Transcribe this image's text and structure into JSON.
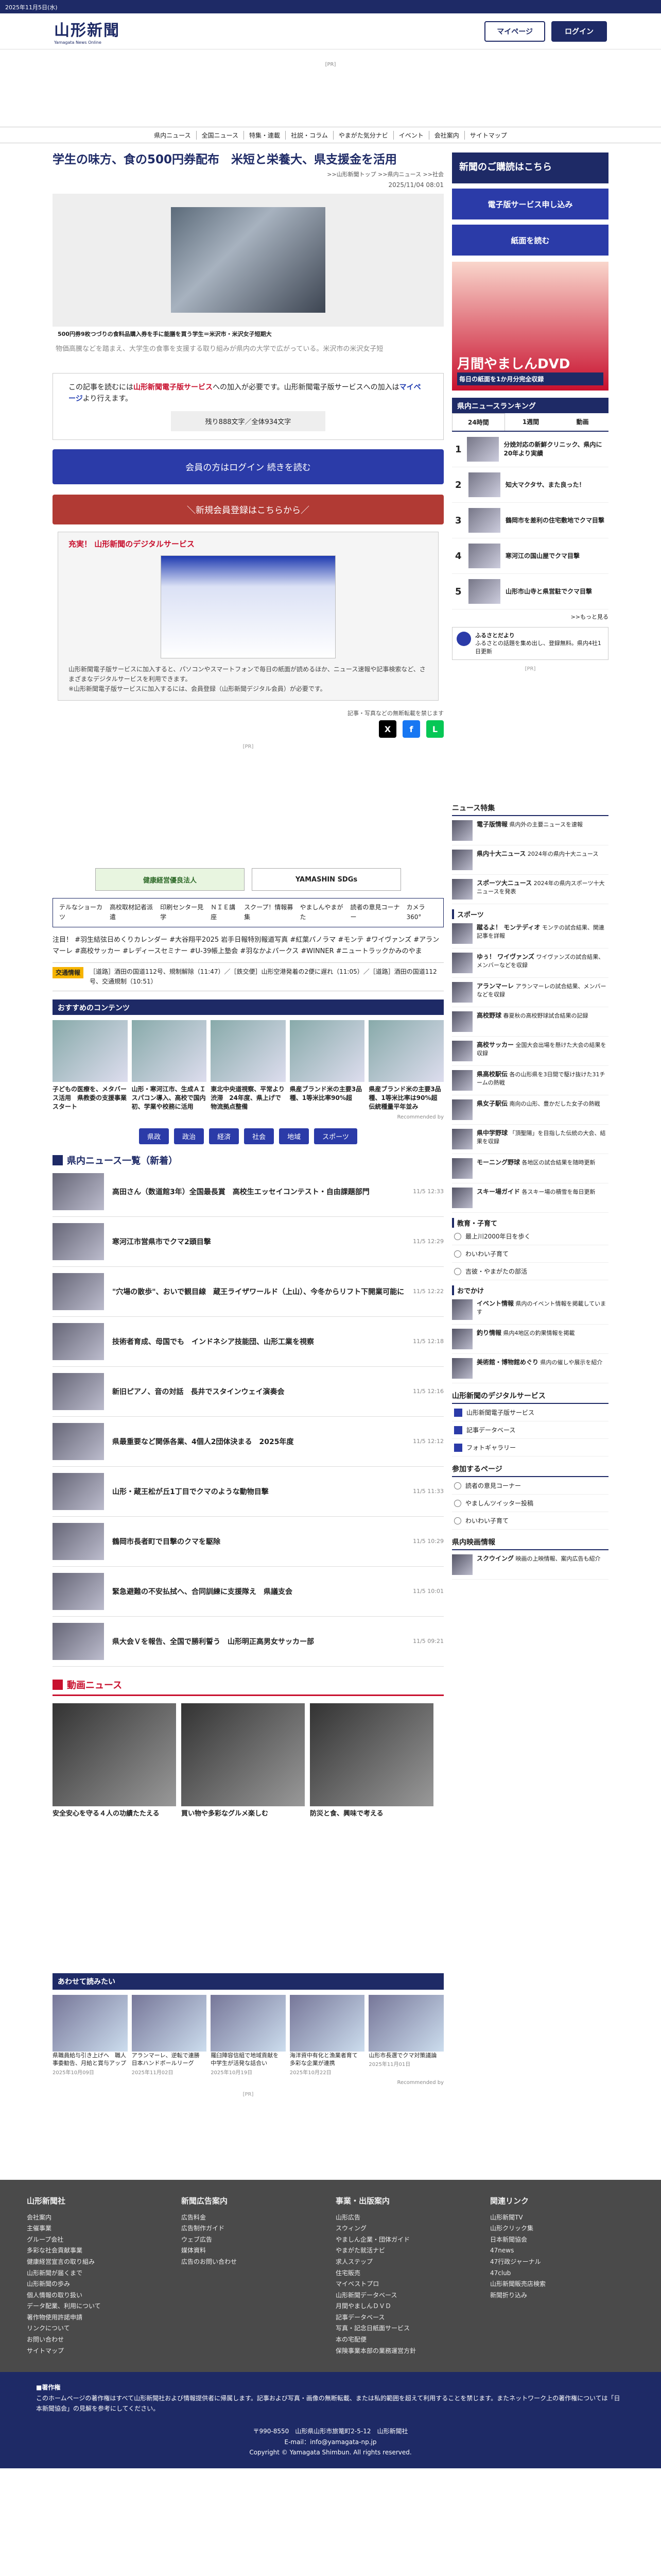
{
  "topbar": {
    "date": "2025年11月5日(水)"
  },
  "masthead": {
    "logo": "山形新聞",
    "logo_sub": "Yamagata News Online",
    "mypage": "マイページ",
    "login": "ログイン"
  },
  "pr": "[PR]",
  "gnav": [
    "県内ニュース",
    "全国ニュース",
    "特集・連載",
    "社説・コラム",
    "やまがた気分ナビ",
    "イベント",
    "会社案内",
    "サイトマップ"
  ],
  "article": {
    "title": "学生の味方、食の500円券配布　米短と栄養大、県支援金を活用",
    "breadcrumb": ">>山形新聞トップ >>県内ニュース >>社会",
    "date": "2025/11/04 08:01",
    "caption": "500円券9枚つづりの食料品購入券を手に能膳を買う学生＝米沢市・米沢女子短期大",
    "lead": "物価高騰などを踏まえ、大学生の食事を支援する取り組みが県内の大学で広がっている。米沢市の米沢女子短",
    "pw_1": "この記事を読むには",
    "pw_red": "山形新聞電子版サービス",
    "pw_2": "への加入が必要です。山形新聞電子版サービスへの加入は",
    "pw_blue": "マイページ",
    "pw_3": "より行えます。",
    "remain": "残り888文字／全体934文字",
    "continue_btn": "会員の方はログイン 続きを読む",
    "register_btn": "＼新規会員登録はこちらから／",
    "promo_title": "充実！ 山形新聞のデジタルサービス",
    "promo_text": "山形新聞電子版サービスに加入すると、パソコンやスマートフォンで毎日の紙面が読めるほか、ニュース速報や記事検索など、さまざまなデジタルサービスを利用できます。",
    "promo_note": "※山形新聞電子版サービスに加入するには、会員登録（山形新聞デジタル会員）が必要です。",
    "share_note": "記事・写真などの無断転載を禁じます"
  },
  "banners": [
    "健康経営優良法人",
    "YAMASHIN SDGs"
  ],
  "tagbox": [
    "テルなショーカツ",
    "高校取材記者派遣",
    "印刷センター見学",
    "ＮＩＥ講座",
    "スクープ！情報募集",
    "やましんやまがた",
    "読者の意見コーナー",
    "カメラ360°"
  ],
  "tags": "注目！ #羽生結弦日めくりカレンダー #大谷翔平2025 岩手日報特別報道写真 #紅葉パノラマ #モンテ #ワイヴァンズ #アランマーレ #高校サッカー #レディースセミナー #U-39帳上塾会 #羽なかよパークス #WINNER #ニュートラックかみのやま",
  "traffic": {
    "label": "交通情報",
    "text": "［道路］酒田の国道112号、規制解除（11:47）／［鉄交便］山形空港発着の2便に遅れ（11:05）／［道路］酒田の国道112号、交通規制（10:51）"
  },
  "recommend": {
    "title": "おすすめのコンテンツ",
    "items": [
      "子どもの医療を、メタバース活用　県教委の支援事業スタート",
      "山形・寒河江市、生成ＡＩスパコン導入、高校で国内初、学業や校務に活用",
      "東北中央道視察、平常より渋滞　24年度、県上げで物流拠点整備",
      "県産ブランド米の主要3品種、1等米比率90%超",
      "県産ブランド米の主要3品種、1等米比率は90%超 伝統種量平年並み"
    ],
    "rec_note": "Recommended by"
  },
  "categories": [
    "県政",
    "政治",
    "経済",
    "社会",
    "地域",
    "スポーツ"
  ],
  "news_list": {
    "title": "県内ニュース一覧（新着）",
    "items": [
      {
        "t": "高田さん（数道館3年）全国最長賞　高校生エッセイコンテスト・自由課題部門",
        "d": "11/5 12:33"
      },
      {
        "t": "寒河江市営県市でクマ2頭目撃",
        "d": "11/5 12:29"
      },
      {
        "t": "\"穴場の散歩\"、おいで観目線　蔵王ライザワールド（上山）、今冬からリフト下開業可能に",
        "d": "11/5 12:22"
      },
      {
        "t": "技術者育成、母国でも　インドネシア技能団、山形工業を視察",
        "d": "11/5 12:18"
      },
      {
        "t": "新旧ピアノ、音の対話　長井でスタインウェイ演奏会",
        "d": "11/5 12:16"
      },
      {
        "t": "県最重要など関係各業、4個人2団体決まる　2025年度",
        "d": "11/5 12:12"
      },
      {
        "t": "山形・蔵王松が丘1丁目でクマのような動物目撃",
        "d": "11/5 11:33"
      },
      {
        "t": "鶴岡市長者町で目撃のクマを駆除",
        "d": "11/5 10:29"
      },
      {
        "t": "緊急避難の不安払拭へ、合同訓練に支援隊え　県議支会",
        "d": "11/5 10:01"
      },
      {
        "t": "県大会Ｖを報告、全国で勝利誓う　山形明正高男女サッカー部",
        "d": "11/5 09:21"
      }
    ]
  },
  "video": {
    "title": "動画ニュース",
    "items": [
      "安全安心を守る４人の功績たたえる",
      "買い物や多彩なグルメ楽しむ",
      "防災と食、興味で考える"
    ]
  },
  "reco2": {
    "title": "あわせて読みたい",
    "items": [
      {
        "t": "県職員給与引き上げへ　職人事委勧告、月給と賞与アップ",
        "d": "2025年10月09日"
      },
      {
        "t": "アランマーレ、逆転で連勝　日本ハンドボールリーグ",
        "d": "2025年11月02日"
      },
      {
        "t": "羅臼陣容信組で地域貢献を　中学生が活発な話合い",
        "d": "2025年10月19日"
      },
      {
        "t": "海洋資中有化と漁業者育て　多彩な企業が連携",
        "d": "2025年10月22日"
      },
      {
        "t": "山形市長選でクマ対策議論",
        "d": "2025年11月01日"
      }
    ],
    "rec_note": "Recommended by"
  },
  "sidebar": {
    "login_title": "新聞のご購読はこちら",
    "btn_digital": "電子版サービス申し込み",
    "btn_paper": "紙面を読む",
    "ad_title": "月間やましんDVD",
    "ad_sub": "毎日の紙面を1か月分完全収録",
    "ranking_title": "県内ニュースランキング",
    "ranking_tabs": [
      "24時間",
      "1週間",
      "動画"
    ],
    "ranking": [
      "分娩対応の新鮮クリニック、県内に20年より実績",
      "知大マクタサ、また良った！",
      "鶴岡市を差利の住宅敷地でクマ目撃",
      "寒河江の国山屋でクマ目撃",
      "山形市山寺と県営駐でクマ目撃"
    ],
    "more": ">>もっと見る",
    "furusato_title": "ふるさとだより",
    "furusato_text": "ふるさとの話題を集め出し、登録無料。県内4社1日更新",
    "features_title": "ニュース特集",
    "features": [
      {
        "b": "電子版情報",
        "t": "県内外の主要ニュースを速報"
      },
      {
        "b": "県内十大ニュース",
        "t": "2024年の県内十大ニュース"
      },
      {
        "b": "スポーツ大ニュース",
        "t": "2024年の県内スポーツ十大ニュースを発表"
      }
    ],
    "sports_title": "スポーツ",
    "sports": [
      {
        "b": "蹴るよ！ モンテディオ",
        "t": "モンテの試合結果、関連記事を詳報"
      },
      {
        "b": "ゆぅ！ ワイヴァンズ",
        "t": "ワイヴァンズの試合結果、メンバーなどを収録"
      },
      {
        "b": "アランマーレ",
        "t": "アランマーレの試合結果、メンバーなどを収録"
      },
      {
        "b": "高校野球",
        "t": "春夏秋の高校野球試合結果の記録"
      },
      {
        "b": "高校サッカー",
        "t": "全国大会出場を懸けた大会の結果を収録"
      },
      {
        "b": "県高校駅伝",
        "t": "各の山形県を3日間で駆け抜けた31チームの熱戦"
      },
      {
        "b": "県女子駅伝",
        "t": "南向の山形、豊かだした女子の熱戦"
      },
      {
        "b": "県中学野球",
        "t": "「頂聖陽」を目指した伝統の大会、結果を収録"
      },
      {
        "b": "モーニング野球",
        "t": "各地区の試合結果を随時更新"
      },
      {
        "b": "スキー場ガイド",
        "t": "各スキー場の積雪を毎日更新"
      }
    ],
    "edu_title": "教育・子育て",
    "edu": [
      "最上川2000年日を歩く",
      "わいわい子育て",
      "吉彼・やまがたの部活"
    ],
    "outing_title": "おでかけ",
    "outing": [
      {
        "b": "イベント情報",
        "t": "県内のイベント情報を掲載しています"
      },
      {
        "b": "釣り情報",
        "t": "県内4地区の釣果情報を掲載"
      },
      {
        "b": "美術館・博物館めぐり",
        "t": "県内の催しや展示を紹介"
      }
    ],
    "digital_title": "山形新聞のデジタルサービス",
    "digital": [
      "山形新聞電子版サービス",
      "記事データベース",
      "フォトギャラリー"
    ],
    "join_title": "参加するページ",
    "join": [
      "読者の意見コーナー",
      "やましんツイッター投稿",
      "わいわい子育て"
    ],
    "pet_title": "県内映画情報",
    "pet": [
      {
        "b": "スクウイング",
        "t": "映画の上映情報、案内広告も紹介"
      }
    ]
  },
  "footer": {
    "cols": [
      {
        "h": "山形新聞社",
        "items": [
          "会社案内",
          "主催事業",
          "グループ会社",
          "多彩な社会貢献事業",
          "健康経営宣言の取り組み",
          "山形新聞が届くまで",
          "山形新聞の歩み",
          "個人情報の取り扱い",
          "データ配業、利用について",
          "著作物使用許諾申請",
          "リンクについて",
          "お問い合わせ",
          "サイトマップ"
        ]
      },
      {
        "h": "新聞広告案内",
        "items": [
          "広告料金",
          "広告制作ガイド",
          "ウェブ広告",
          "媒体資料",
          "広告のお問い合わせ"
        ]
      },
      {
        "h": "事業・出版案内",
        "items": [
          "山形広告",
          "スウィング",
          "やましん企業・団体ガイド",
          "やまがた就活ナビ",
          "求人ステップ",
          "住宅販売",
          "マイベストプロ",
          "山形新聞データベース",
          "月間やましんＤＶＤ",
          "記事データベース",
          "写真・記念日紙面サービス",
          "本の宅配便",
          "保険事業本部の業務運営方針"
        ]
      },
      {
        "h": "関連リンク",
        "items": [
          "山形新聞TV",
          "山形クリック集",
          "日本新聞協会",
          "47news",
          "47行政ジャーナル",
          "47club",
          "山形新聞販売店検索",
          "新聞折り込み"
        ]
      }
    ],
    "copyright_label": "■著作権",
    "copyright": "このホームページの著作権はすべて山形新聞社および情報提供者に帰属します。記事および写真・画像の無断転載、または私的範囲を超えて利用することを禁じます。またネットワーク上の著作権については「日本新聞協会」の見解を参考にしてください。",
    "address": "〒990-8550　山形県山形市旅篭町2-5-12　山形新聞社",
    "email": "E-mail：info@yamagata-np.jp",
    "copy": "Copyright © Yamagata Shimbun. All rights reserved."
  }
}
